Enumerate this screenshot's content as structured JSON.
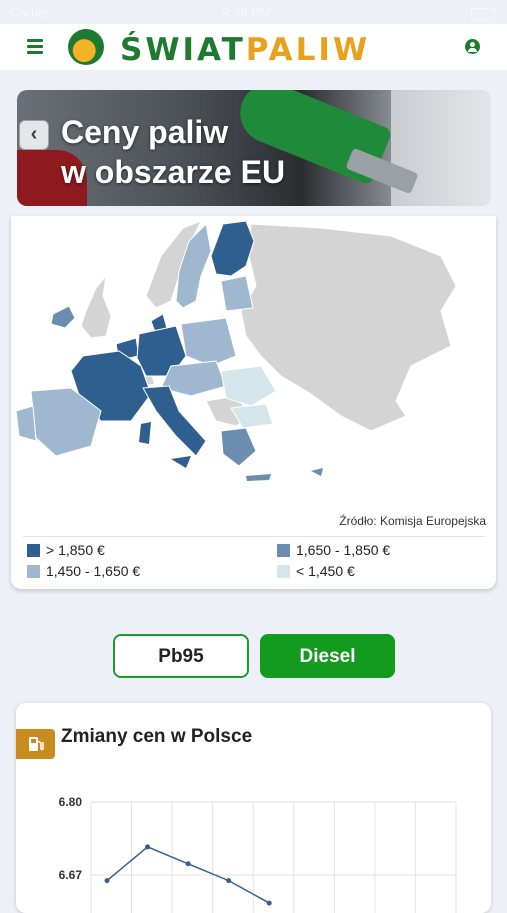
{
  "status_bar": {
    "carrier": "Carrier",
    "time": "9:38 PM"
  },
  "header": {
    "logo_word1": "ŚWIAT",
    "logo_word2": "PALIW"
  },
  "hero": {
    "title": "Ceny paliw\nw obszarze EU",
    "back_glyph": "‹"
  },
  "map": {
    "source": "Źródło: Komisja Europejska",
    "legend": [
      {
        "label": "> 1,850 €",
        "color": "#2f5f8f"
      },
      {
        "label": "1,650 - 1,850 €",
        "color": "#6a8db0"
      },
      {
        "label": "1,450 - 1,650 €",
        "color": "#9fb8d0"
      },
      {
        "label": "< 1,450 €",
        "color": "#d4e6ea"
      }
    ],
    "no_data_color": "#d4d4d4"
  },
  "fuel_tabs": {
    "pb95": "Pb95",
    "diesel": "Diesel",
    "selected": "Diesel"
  },
  "chart_panel": {
    "title": "Zmiany cen w Polsce",
    "icon": "fuel-pump-icon",
    "accent": "#c98a1e"
  },
  "chart_data": {
    "type": "line",
    "title": "Zmiany cen w Polsce",
    "xlabel": "",
    "ylabel": "",
    "yticks": [
      "6.80",
      "6.67"
    ],
    "ylim_visible": [
      6.6,
      6.8
    ],
    "grid": true,
    "series": [
      {
        "color": "#3a5f8f",
        "values": [
          6.66,
          6.72,
          6.69,
          6.66,
          6.62
        ]
      }
    ]
  }
}
